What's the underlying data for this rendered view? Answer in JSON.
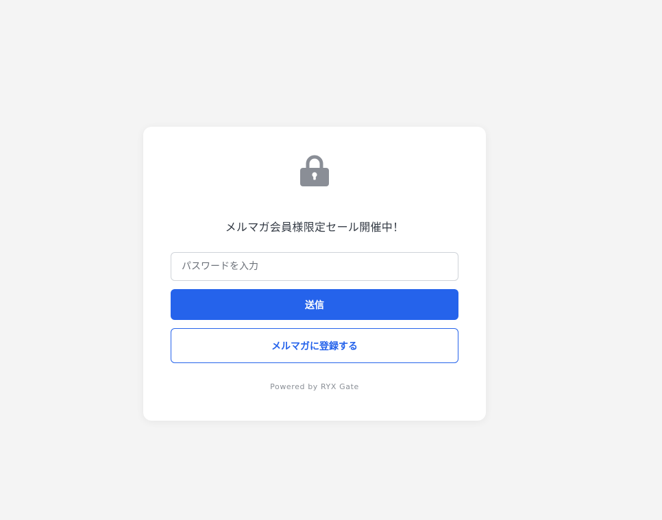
{
  "gate": {
    "lock_icon": "lock-icon",
    "message": "メルマガ会員様限定セール開催中！",
    "password_placeholder": "パスワードを入力",
    "password_value": "",
    "submit_label": "送信",
    "register_label": "メルマガに登録する",
    "powered_by": "Powered by RYX Gate"
  },
  "colors": {
    "background": "#f4f4f4",
    "card": "#ffffff",
    "accent": "#2563eb",
    "icon": "#8a8e96"
  }
}
